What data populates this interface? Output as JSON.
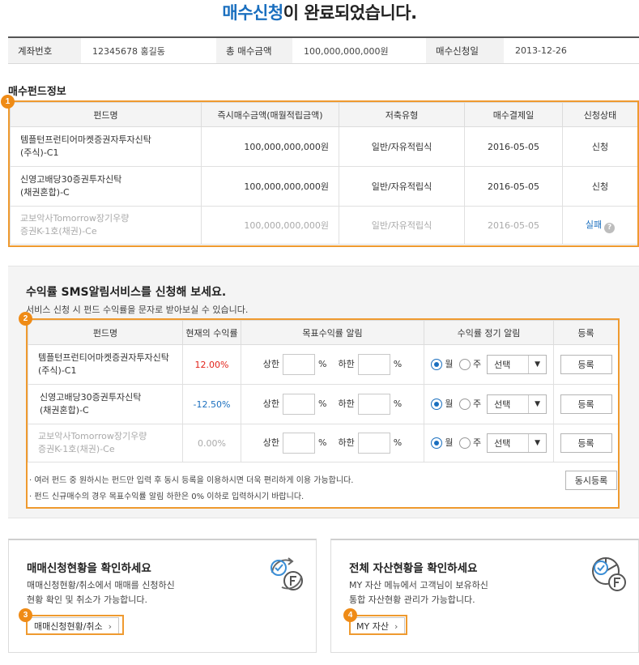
{
  "title": {
    "highlight": "매수신청",
    "rest": "이 완료되었습니다."
  },
  "summary": {
    "account_label": "계좌번호",
    "account_value": "12345678 홍길동",
    "total_label": "총 매수금액",
    "total_value": "100,000,000,000원",
    "date_label": "매수신청일",
    "date_value": "2013-12-26"
  },
  "fund_info": {
    "section_title": "매수펀드정보",
    "badge": "1",
    "headers": [
      "펀드명",
      "즉시매수금액(매월적립금액)",
      "저축유형",
      "매수결제일",
      "신청상태"
    ],
    "rows": [
      {
        "name_line1": "템플턴프런티어마켓증권자투자신탁",
        "name_line2": "(주식)-C1",
        "amount": "100,000,000,000원",
        "type": "일반/자유적립식",
        "date": "2016-05-05",
        "status": "신청"
      },
      {
        "name_line1": "신영고배당30증권투자신탁",
        "name_line2": "(채권혼합)-C",
        "amount": "100,000,000,000원",
        "type": "일반/자유적립식",
        "date": "2016-05-05",
        "status": "신청"
      },
      {
        "name_line1": "교보악사Tomorrow장기우량",
        "name_line2": "증권K-1호(채권)-Ce",
        "amount": "100,000,000,000원",
        "type": "일반/자유적립식",
        "date": "2016-05-05",
        "status": "실패"
      }
    ],
    "help_icon": "question-icon"
  },
  "sms": {
    "title": "수익률 SMS알림서비스를 신청해 보세요.",
    "subtitle": "서비스 신청 시 펀드 수익률을 문자로 받아보실 수 있습니다.",
    "badge": "2",
    "headers": [
      "펀드명",
      "현재의 수익률",
      "목표수익률 알림",
      "수익률 정기 알림",
      "등록"
    ],
    "upper_label": "상한",
    "lower_label": "하한",
    "percent": "%",
    "month_label": "월",
    "week_label": "주",
    "select_value": "선택",
    "register_label": "등록",
    "rows": [
      {
        "name_line1": "템플턴프런티어마켓증권자투자신탁",
        "name_line2": "(주식)-C1",
        "rate": "12.00%"
      },
      {
        "name_line1": "신영고배당30증권투자신탁",
        "name_line2": "(채권혼합)-C",
        "rate": "-12.50%"
      },
      {
        "name_line1": "교보악사Tomorrow장기우량",
        "name_line2": "증권K-1호(채권)-Ce",
        "rate": "0.00%"
      }
    ],
    "note1": "· 여러 펀드 중 원하시는 펀드만 입력 후 동시 등록을 이용하시면 더욱 편리하게 이용 가능합니다.",
    "note2": "· 펀드 신규매수의 경우 목표수익률 알림 하한은 0% 이하로 입력하시기 바랍니다.",
    "bulk_register": "동시등록"
  },
  "cards": [
    {
      "title": "매매신청현황을 확인하세요",
      "desc1": "매매신청현황/취소에서 매매를 신청하신",
      "desc2": "현황 확인 및 취소가 가능합니다.",
      "button": "매매신청현황/취소",
      "badge": "3",
      "icon": "fund-exchange-icon"
    },
    {
      "title": "전체 자산현황을 확인하세요",
      "desc1": "MY 자산 메뉴에서 고객님이 보유하신",
      "desc2": "통합 자산현황 관리가 가능합니다.",
      "button": "MY 자산",
      "badge": "4",
      "icon": "asset-pie-icon"
    }
  ],
  "colors": {
    "accent": "#1a6fbf",
    "highlight_box": "#ef9a2f",
    "negative": "#e2231a"
  }
}
